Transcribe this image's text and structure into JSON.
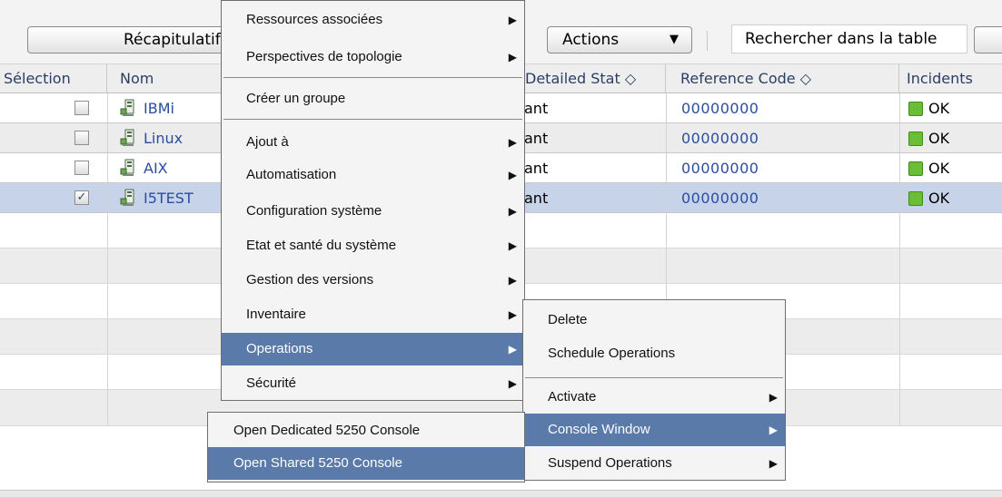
{
  "toolbar": {
    "summary_label": "Récapitulatif",
    "actions_label": "Actions",
    "actions_arrow": "▼",
    "search_placeholder": "Rechercher dans la table"
  },
  "table": {
    "headers": {
      "select": "Sélection",
      "name": "Nom",
      "detailed_status": "Detailed Stat ◇",
      "reference_code": "Reference Code   ◇",
      "incidents": "Incidents"
    },
    "rows": [
      {
        "checked": false,
        "name": "IBMi",
        "status": "ant",
        "code": "00000000",
        "incident": "OK"
      },
      {
        "checked": false,
        "name": "Linux",
        "status": "ant",
        "code": "00000000",
        "incident": "OK"
      },
      {
        "checked": false,
        "name": "AIX",
        "status": "ant",
        "code": "00000000",
        "incident": "OK"
      },
      {
        "checked": true,
        "name": "I5TEST",
        "status": "ant",
        "code": "00000000",
        "incident": "OK"
      }
    ],
    "check_mark": "✓"
  },
  "menu_main": {
    "items": [
      {
        "label": "Ressources associées",
        "sub": "▶"
      },
      {
        "label": "Perspectives de topologie",
        "sub": "▶"
      },
      {
        "label": "Créer un groupe",
        "sub": ""
      },
      {
        "label": "Ajout à",
        "sub": "▶"
      },
      {
        "label": "Automatisation",
        "sub": "▶"
      },
      {
        "label": "Configuration système",
        "sub": "▶"
      },
      {
        "label": "Etat et santé du système",
        "sub": "▶"
      },
      {
        "label": "Gestion des versions",
        "sub": "▶"
      },
      {
        "label": "Inventaire",
        "sub": "▶"
      },
      {
        "label": "Operations",
        "sub": "▶"
      },
      {
        "label": "Sécurité",
        "sub": "▶"
      }
    ]
  },
  "menu_operations": {
    "items": [
      {
        "label": "Delete",
        "sub": ""
      },
      {
        "label": "Schedule Operations",
        "sub": ""
      },
      {
        "label": "Activate",
        "sub": "▶"
      },
      {
        "label": "Console Window",
        "sub": "▶"
      },
      {
        "label": "Suspend Operations",
        "sub": "▶"
      }
    ]
  },
  "menu_console": {
    "items": [
      {
        "label": "Open Dedicated 5250 Console"
      },
      {
        "label": "Open Shared 5250 Console"
      }
    ]
  },
  "colors": {
    "menu_highlight": "#5a7aaa",
    "link": "#2b4da1",
    "ok_green": "#6bbd35",
    "selected_row": "#c7d3e8"
  }
}
